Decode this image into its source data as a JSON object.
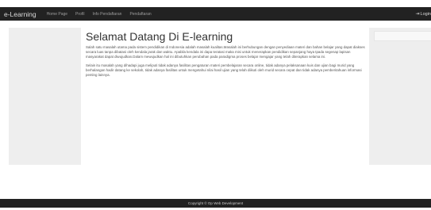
{
  "navbar": {
    "brand": "e-Learning",
    "items": [
      {
        "label": "Home Page"
      },
      {
        "label": "Profil"
      },
      {
        "label": "Info Pendaftaran"
      },
      {
        "label": "Pendaftaran"
      }
    ],
    "login_label": "Login"
  },
  "main": {
    "title": "Selamat Datang Di E-learning",
    "paragraphs": [
      "Salah satu masalah utama pada sistem pendidikan di Indonesia adalah masalah kualitas.Masalah ini berhubungan dengan penyediaan materi dan bahan belajar yang dapat diakses secara luas tanpa dibatasi oleh kendala jarak dan waktu. Apabila kendala ini dapa teratasi maka misi untuk menerapkan pendidikan sepanjang haya tpada segenap lapisan masyarakat dapat diwujudkan.Dalam mewujudkan hal ini dibutuhkan perubahan pada paradigma proses belajar mengajar yang telah diterapkan selama ini.",
      "Selain itu masalah yang dihadapi juga meliputi tidak adanya fasilitas pengaturan materi pembelajaran secara online, tidak adanya pelaksanaan kuis dan ujian bagi murid yang berhalangan hadir datang ke sekolah, tidak adanya fasilitas untuk mengetahui nilai hasil ujian yang telah diikuti oleh murid secara cepat dan tidak adanya pemberitahuan informasi penting lainnya."
    ]
  },
  "footer": {
    "text": "Copyright © Op Web Development"
  },
  "colors": {
    "navbar_bg": "#222222",
    "sidebar_bg": "#eeeeee",
    "footer_bg": "#222222"
  }
}
